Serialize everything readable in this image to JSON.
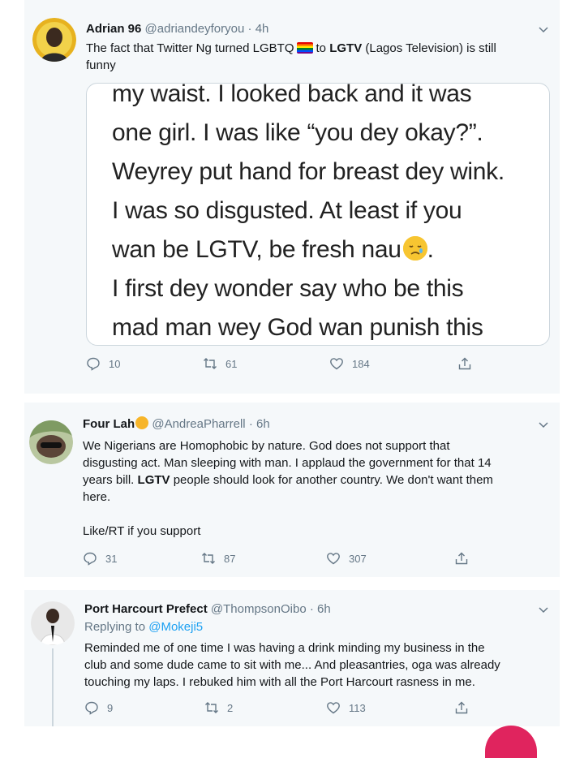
{
  "tweets": [
    {
      "author": "Adrian 96",
      "handle": "@adriandeyforyou",
      "sep": "·",
      "time": "4h",
      "text_a": "The fact that Twitter Ng turned LGBTQ",
      "text_b": "to",
      "text_bold": "LGTV",
      "text_c": "(Lagos Television) is still",
      "text_d": "funny",
      "media_lines": [
        "my waist. I looked back and it was",
        "one girl. I was like “you dey okay?”.",
        "Weyrey put hand for breast dey wink.",
        "I was so disgusted. At least if you",
        "wan be LGTV, be fresh nau",
        "I first dey wonder say who be this",
        "mad man wey God wan punish this"
      ],
      "media_line5_end": ".",
      "replies": "10",
      "retweets": "61",
      "likes": "184"
    },
    {
      "author": "Four Lah",
      "handle": "@AndreaPharrell",
      "sep": "·",
      "time": "6h",
      "line1": "We Nigerians are Homophobic by nature. God does not support that",
      "line2": "disgusting act. Man sleeping with man. I applaud the government for that 14",
      "line3_a": "years bill.",
      "line3_bold": "LGTV",
      "line3_b": "people should look for another country. We don't want them",
      "line4": "here.",
      "line5": "Like/RT if you support",
      "replies": "31",
      "retweets": "87",
      "likes": "307"
    },
    {
      "author": "Port Harcourt Prefect",
      "handle": "@ThompsonOibo",
      "sep": "·",
      "time": "6h",
      "replying_label": "Replying to",
      "replying_to": "@Mokeji5",
      "line1": "Reminded me of one time I was having a drink minding my business in the",
      "line2": "club and some dude came to sit with me... And pleasantries, oga was already",
      "line3": "touching my laps. I rebuked him with all the Port Harcourt rasness  in me.",
      "replies": "9",
      "retweets": "2",
      "likes": "113"
    }
  ],
  "colors": {
    "card_bg": "#f5f8fa",
    "text": "#14171a",
    "muted": "#657786",
    "link": "#1da1f2",
    "border": "#ccd6dd",
    "accent_red": "#e0245e"
  },
  "icons": [
    "chevron-down-icon",
    "reply-icon",
    "retweet-icon",
    "like-icon",
    "share-icon",
    "rainbow-flag-icon",
    "emoji-icon"
  ]
}
